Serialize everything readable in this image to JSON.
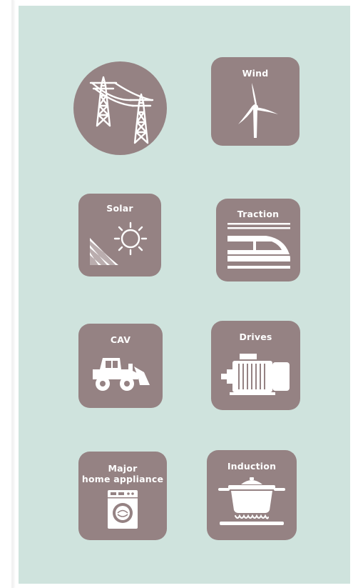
{
  "colors": {
    "background": "#cfe3dd",
    "tile": "#958283",
    "icon": "#ffffff"
  },
  "tiles": {
    "grid": {
      "label": "",
      "icon": "power-transmission-tower-icon"
    },
    "wind": {
      "label": "Wind",
      "icon": "wind-turbine-icon"
    },
    "solar": {
      "label": "Solar",
      "icon": "sun-panel-icon"
    },
    "traction": {
      "label": "Traction",
      "icon": "high-speed-train-icon"
    },
    "cav": {
      "label": "CAV",
      "icon": "wheel-loader-icon"
    },
    "drives": {
      "label": "Drives",
      "icon": "electric-motor-icon"
    },
    "appliance": {
      "label_line1": "Major",
      "label_line2": "home appliance",
      "icon": "washing-machine-icon"
    },
    "induction": {
      "label": "Induction",
      "icon": "cooking-pot-icon"
    }
  }
}
